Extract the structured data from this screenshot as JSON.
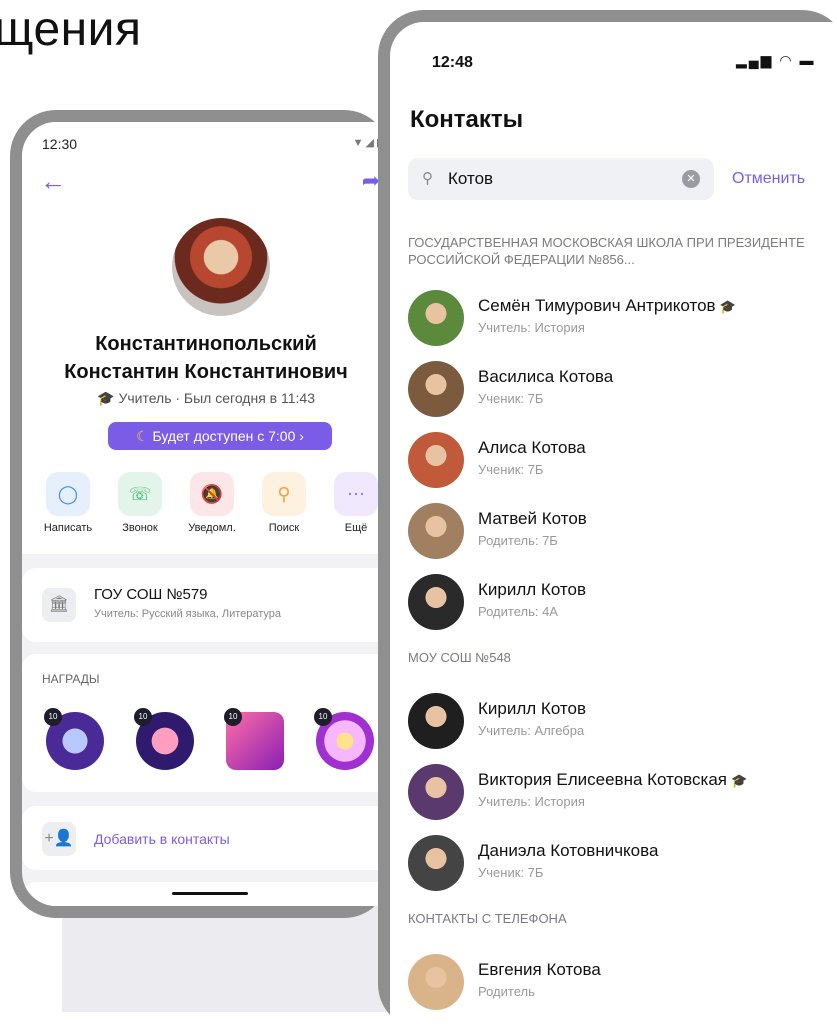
{
  "heading": "щения",
  "left_phone": {
    "status_time": "12:30",
    "status_icons": "▼◢▮",
    "name_line1": "Константинопольский",
    "name_line2": "Константин Константинович",
    "role": "Учитель · Был сегодня в 11:43",
    "availability": "Будет доступен с 7:00",
    "actions": [
      {
        "label": "Написать",
        "icon": "message-icon",
        "color": "#3a8be8"
      },
      {
        "label": "Звонок",
        "icon": "phone-icon",
        "color": "#34b36a"
      },
      {
        "label": "Уведомл.",
        "icon": "bell-off-icon",
        "color": "#e5484d"
      },
      {
        "label": "Поиск",
        "icon": "search-icon",
        "color": "#f2a23a"
      },
      {
        "label": "Ещё",
        "icon": "more-icon",
        "color": "#9b6cf0"
      }
    ],
    "school": {
      "name": "ГОУ СОШ №579",
      "subtitle": "Учитель: Русский языка, Литература"
    },
    "awards_title": "НАГРАДЫ",
    "awards": [
      {
        "count": "10"
      },
      {
        "count": "10"
      },
      {
        "count": "10"
      },
      {
        "count": "10"
      }
    ],
    "add_contact": "Добавить в контакты"
  },
  "right_phone": {
    "status_time": "12:48",
    "title": "Контакты",
    "search_value": "Котов",
    "cancel_label": "Отменить",
    "sections": [
      {
        "title": "ГОСУДАРСТВЕННАЯ МОСКОВСКАЯ ШКОЛА ПРИ ПРЕЗИДЕНТЕ РОССИЙСКОЙ ФЕДЕРАЦИИ №856...",
        "contacts": [
          {
            "name": "Семён Тимурович Антрикотов",
            "role": "Учитель: История",
            "verified": true
          },
          {
            "name": "Василиса Котова",
            "role": "Ученик: 7Б",
            "verified": false
          },
          {
            "name": "Алиса Котова",
            "role": "Ученик: 7Б",
            "verified": false
          },
          {
            "name": "Матвей Котов",
            "role": "Родитель: 7Б",
            "verified": false
          },
          {
            "name": "Кирилл Котов",
            "role": "Родитель: 4А",
            "verified": false
          }
        ]
      },
      {
        "title": "МОУ СОШ №548",
        "contacts": [
          {
            "name": "Кирилл Котов",
            "role": "Учитель: Алгебра",
            "verified": false
          },
          {
            "name": "Виктория Елисеевна Котовская",
            "role": "Учитель: История",
            "verified": true
          },
          {
            "name": "Даниэла Котовничкова",
            "role": "Ученик: 7Б",
            "verified": false
          }
        ]
      },
      {
        "title": "КОНТАКТЫ С ТЕЛЕФОНА",
        "contacts": [
          {
            "name": "Евгения Котова",
            "role": "Родитель",
            "verified": false
          }
        ]
      }
    ]
  }
}
